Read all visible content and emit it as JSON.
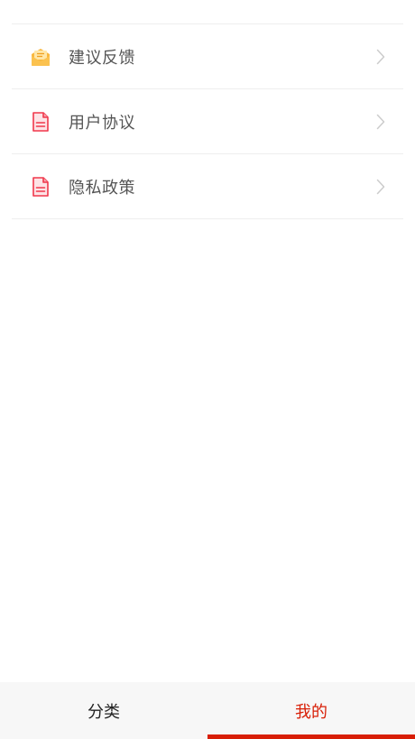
{
  "menu": {
    "items": [
      {
        "label": "建议反馈",
        "icon": "feedback-envelope-icon"
      },
      {
        "label": "用户协议",
        "icon": "document-icon"
      },
      {
        "label": "隐私政策",
        "icon": "document-icon"
      }
    ]
  },
  "tabbar": {
    "tabs": [
      {
        "label": "分类",
        "active": false
      },
      {
        "label": "我的",
        "active": true
      }
    ]
  },
  "colors": {
    "accent": "#d81e06",
    "feedback_icon": "#f9b83e",
    "document_icon": "#f0384c"
  }
}
